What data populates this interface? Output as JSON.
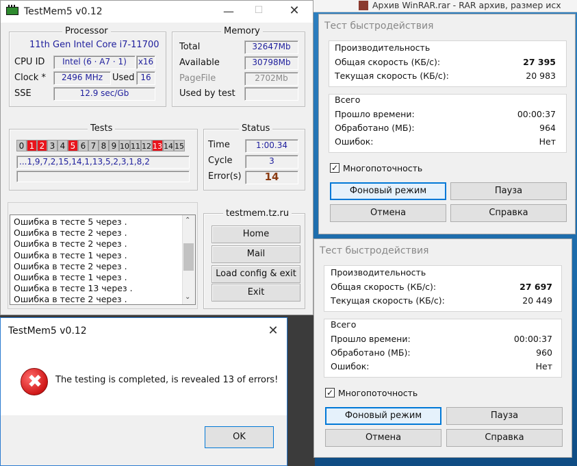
{
  "testmem": {
    "title": "TestMem5 v0.12",
    "processor": {
      "group_label": "Processor",
      "model": "11th Gen Intel Core i7-11700",
      "cpu_id_label": "CPU ID",
      "cpu_id_value": "Intel (6 · A7 · 1)",
      "threads": "x16",
      "clock_label": "Clock *",
      "clock_value": "2496 MHz",
      "used_label": "Used",
      "used_value": "16",
      "sse_label": "SSE",
      "sse_value": "12.9 sec/Gb"
    },
    "memory": {
      "group_label": "Memory",
      "total_label": "Total",
      "total_value": "32647Mb",
      "available_label": "Available",
      "available_value": "30798Mb",
      "pagefile_label": "PageFile",
      "pagefile_value": "2702Mb",
      "usedbytest_label": "Used by test",
      "usedbytest_value": ""
    },
    "tests": {
      "group_label": "Tests",
      "cells": [
        "0",
        "1",
        "2",
        "3",
        "4",
        "5",
        "6",
        "7",
        "8",
        "9",
        "10",
        "11",
        "12",
        "13",
        "14",
        "15"
      ],
      "error_cells": [
        1,
        2,
        5,
        13
      ],
      "sequence": "...1,9,7,2,15,14,1,13,5,2,3,1,8,2",
      "bar": ""
    },
    "status": {
      "group_label": "Status",
      "time_label": "Time",
      "time_value": "1:00.34",
      "cycle_label": "Cycle",
      "cycle_value": "3",
      "errors_label": "Error(s)",
      "errors_value": "14"
    },
    "log": [
      "Ошибка в тесте 5 через .",
      "Ошибка в тесте 2 через .",
      "Ошибка в тесте 2 через .",
      "Ошибка в тесте 1 через .",
      "Ошибка в тесте 2 через .",
      "Ошибка в тесте 1 через .",
      "Ошибка в тесте 13 через .",
      "Ошибка в тесте 2 через ."
    ],
    "site": {
      "label": "testmem.tz.ru",
      "home": "Home",
      "mail": "Mail",
      "load": "Load config & exit",
      "exit": "Exit"
    }
  },
  "dialog": {
    "title": "TestMem5 v0.12",
    "message": "The testing is completed, is revealed 13 of errors!",
    "ok": "OK"
  },
  "background": {
    "top_text": "Архив WinRAR.rar - RAR архив, размер исх"
  },
  "speed1": {
    "title": "Тест быстродействия",
    "perf_label": "Производительность",
    "total_speed_label": "Общая скорость (КБ/с):",
    "total_speed_value": "27 395",
    "current_speed_label": "Текущая скорость (КБ/с):",
    "current_speed_value": "20 983",
    "total_label": "Всего",
    "elapsed_label": "Прошло времени:",
    "elapsed_value": "00:00:37",
    "processed_label": "Обработано (МБ):",
    "processed_value": "964",
    "errors_label": "Ошибок:",
    "errors_value": "Нет",
    "multithread_label": "Многопоточность",
    "btn_background": "Фоновый режим",
    "btn_pause": "Пауза",
    "btn_cancel": "Отмена",
    "btn_help": "Справка"
  },
  "speed2": {
    "title": "Тест быстродействия",
    "perf_label": "Производительность",
    "total_speed_label": "Общая скорость (КБ/с):",
    "total_speed_value": "27 697",
    "current_speed_label": "Текущая скорость (КБ/с):",
    "current_speed_value": "20 449",
    "total_label": "Всего",
    "elapsed_label": "Прошло времени:",
    "elapsed_value": "00:00:37",
    "processed_label": "Обработано (МБ):",
    "processed_value": "960",
    "errors_label": "Ошибок:",
    "errors_value": "Нет",
    "multithread_label": "Многопоточность",
    "btn_background": "Фоновый режим",
    "btn_pause": "Пауза",
    "btn_cancel": "Отмена",
    "btn_help": "Справка"
  }
}
